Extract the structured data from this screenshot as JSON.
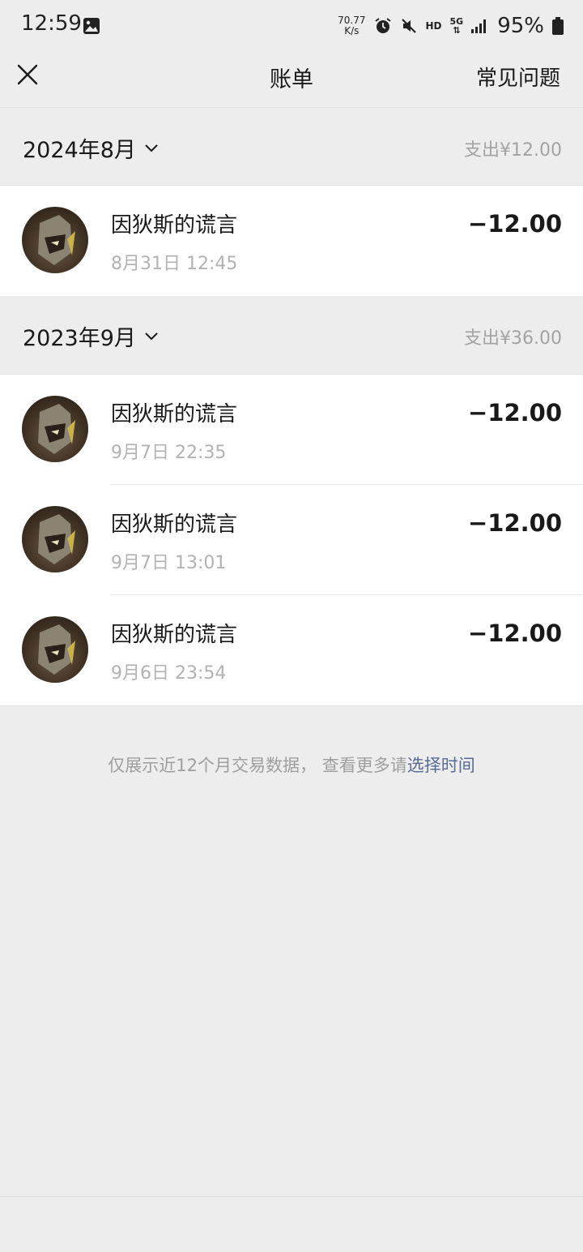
{
  "status": {
    "time": "12:59",
    "net_speed_value": "70.77",
    "net_speed_unit": "K/s",
    "hd": "HD",
    "network": "5G",
    "battery": "95%"
  },
  "nav": {
    "title": "账单",
    "faq": "常见问题"
  },
  "months": [
    {
      "label": "2024年8月",
      "total": "支出¥12.00",
      "transactions": [
        {
          "name": "因狄斯的谎言",
          "time": "8月31日 12:45",
          "amount": "−12.00"
        }
      ]
    },
    {
      "label": "2023年9月",
      "total": "支出¥36.00",
      "transactions": [
        {
          "name": "因狄斯的谎言",
          "time": "9月7日 22:35",
          "amount": "−12.00"
        },
        {
          "name": "因狄斯的谎言",
          "time": "9月7日 13:01",
          "amount": "−12.00"
        },
        {
          "name": "因狄斯的谎言",
          "time": "9月6日 23:54",
          "amount": "−12.00"
        }
      ]
    }
  ],
  "footer": {
    "note": "仅展示近12个月交易数据， 查看更多请",
    "link": "选择时间"
  }
}
